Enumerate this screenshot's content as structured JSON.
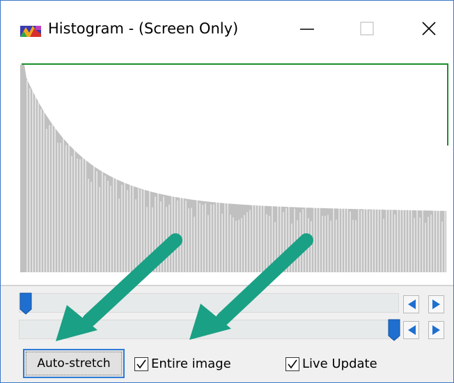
{
  "window": {
    "title": "Histogram - (Screen Only)",
    "icon": "histogram-app-icon",
    "controls": [
      "minimize-icon",
      "maximize-icon",
      "close-icon"
    ]
  },
  "histogram": {
    "fill_color": "#c0c0c0",
    "line_color": "#ffffff",
    "border_color": "#1a8f2a"
  },
  "sliders": {
    "black_point": {
      "level": 0.0
    },
    "white_point": {
      "level": 1.0
    }
  },
  "buttons": {
    "auto_stretch": "Auto-stretch"
  },
  "checkboxes": {
    "entire_image": {
      "label": "Entire image",
      "checked": true
    },
    "live_update": {
      "label": "Live Update",
      "checked": true
    }
  },
  "colors": {
    "accent": "#2e7bd6",
    "slider_thumb": "#1f6fd0",
    "annotation_arrow": "#1aa085"
  }
}
